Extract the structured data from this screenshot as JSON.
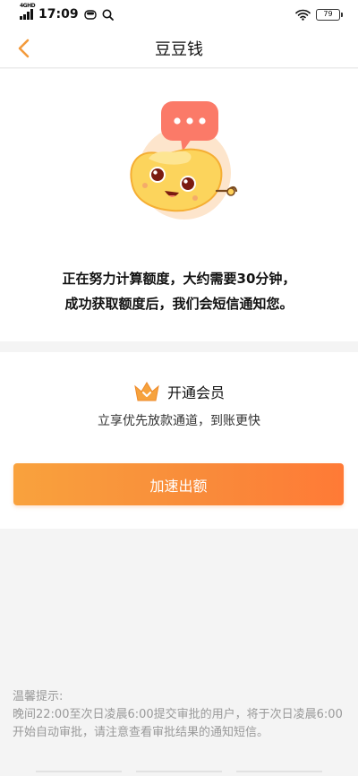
{
  "status_bar": {
    "network": "4GHD",
    "time": "17:09",
    "battery": "79"
  },
  "nav": {
    "title": "豆豆钱"
  },
  "status_card": {
    "line1": "正在努力计算额度，大约需要30分钟，",
    "line2": "成功获取额度后，我们会短信通知您。"
  },
  "vip": {
    "title": "开通会员",
    "desc": "立享优先放款通道，到账更快",
    "button_label": "加速出额",
    "accent": "#f98a3a",
    "crown_color": "#f6a23d"
  },
  "notice": {
    "heading": "温馨提示:",
    "body": "晚间22:00至次日凌晨6:00提交审批的用户，将于次日凌晨6:00开始自动审批，请注意查看审批结果的通知短信。"
  },
  "icons": {
    "back": "chevron-left-icon",
    "mascot": "mascot-illustration",
    "chat": "chat-bubble-icon",
    "crown": "crown-icon"
  }
}
